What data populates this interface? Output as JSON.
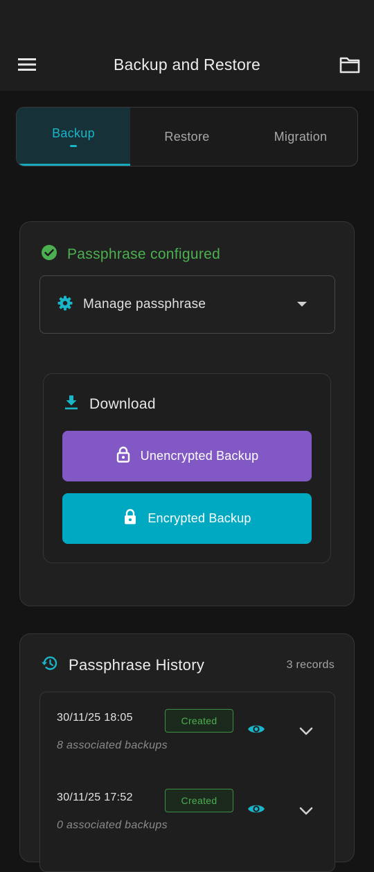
{
  "appbar": {
    "title": "Backup and Restore",
    "menu_icon": "menu-icon",
    "folder_icon": "folder-icon"
  },
  "tabs": [
    {
      "label": "Backup",
      "active": true
    },
    {
      "label": "Restore",
      "active": false
    },
    {
      "label": "Migration",
      "active": false
    }
  ],
  "passphrase": {
    "status_text": "Passphrase configured",
    "status_color": "#4caf50",
    "manage_label": "Manage passphrase"
  },
  "download": {
    "heading": "Download",
    "unencrypted_label": "Unencrypted Backup",
    "encrypted_label": "Encrypted Backup",
    "unencrypted_color": "#8259c4",
    "encrypted_color": "#00a9c2"
  },
  "history": {
    "title": "Passphrase History",
    "records": "3 records",
    "items": [
      {
        "date": "30/11/25 18:05",
        "badge": "Created",
        "count": "8 associated backups"
      },
      {
        "date": "30/11/25 17:52",
        "badge": "Created",
        "count": "0 associated backups"
      }
    ]
  },
  "colors": {
    "accent": "#1ab5c9",
    "background": "#141414",
    "surface": "#202020"
  }
}
